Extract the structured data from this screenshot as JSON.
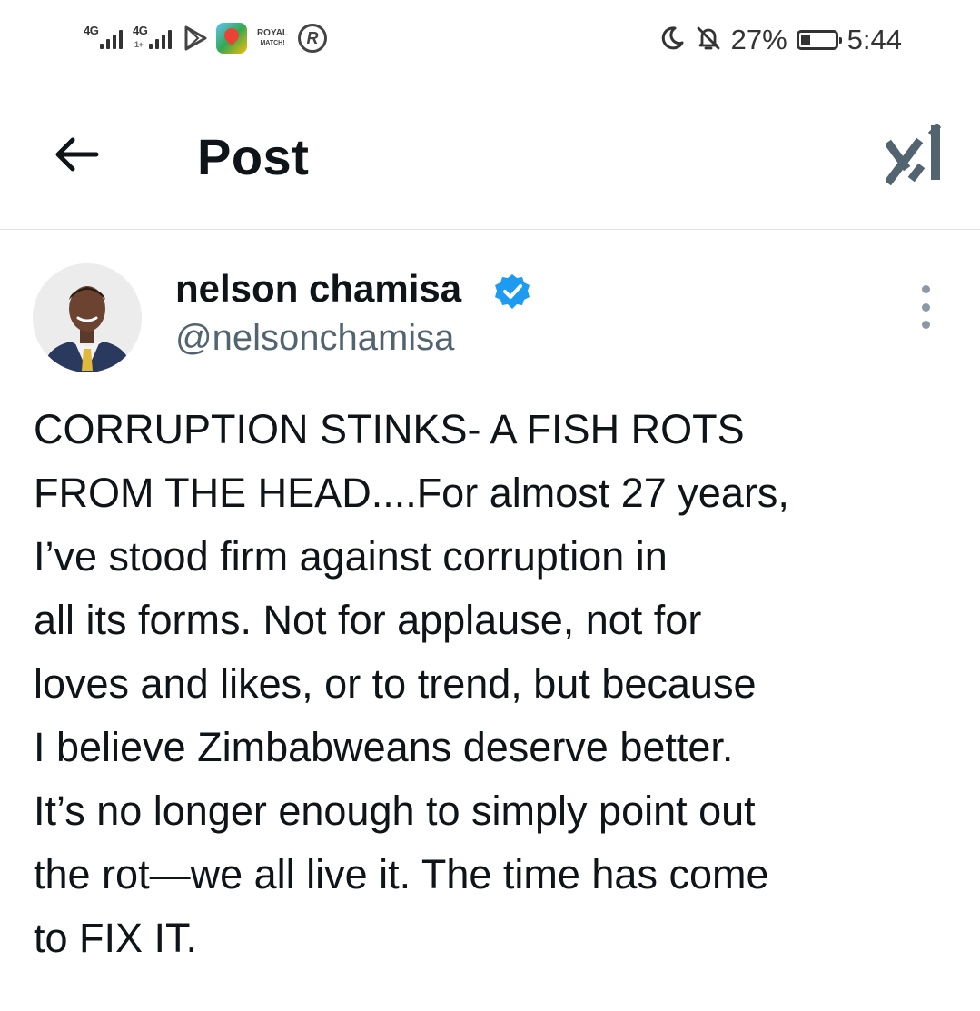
{
  "status_bar": {
    "network_1": "4G",
    "network_2": "4G",
    "network_2_sub": "1+",
    "app_icons": [
      "play-store-icon",
      "maps-icon",
      "royal-match-icon",
      "r-app-icon"
    ],
    "royal_match_label_line1": "ROYAL",
    "royal_match_label_line2": "MATCH!",
    "r_app_label": "R",
    "battery_percent": "27%",
    "time": "5:44"
  },
  "header": {
    "title": "Post",
    "back_icon": "arrow-left-icon",
    "grok_icon": "grok-icon"
  },
  "post": {
    "author_name": "nelson chamisa",
    "verified": true,
    "verified_color": "#1d9bf0",
    "handle": "@nelsonchamisa",
    "text": "CORRUPTION STINKS- A FISH ROTS\nFROM THE HEAD....For almost 27 years,\nI’ve stood firm against corruption in\nall its forms. Not for applause, not for\nloves and likes, or to trend, but because\nI believe Zimbabweans deserve better.\nIt’s no longer enough to simply point out\nthe rot—we all live it. The time has come\nto FIX IT."
  },
  "colors": {
    "text_primary": "#0f1419",
    "text_secondary": "#536471",
    "divider": "#dfe3e6",
    "accent": "#1d9bf0"
  }
}
